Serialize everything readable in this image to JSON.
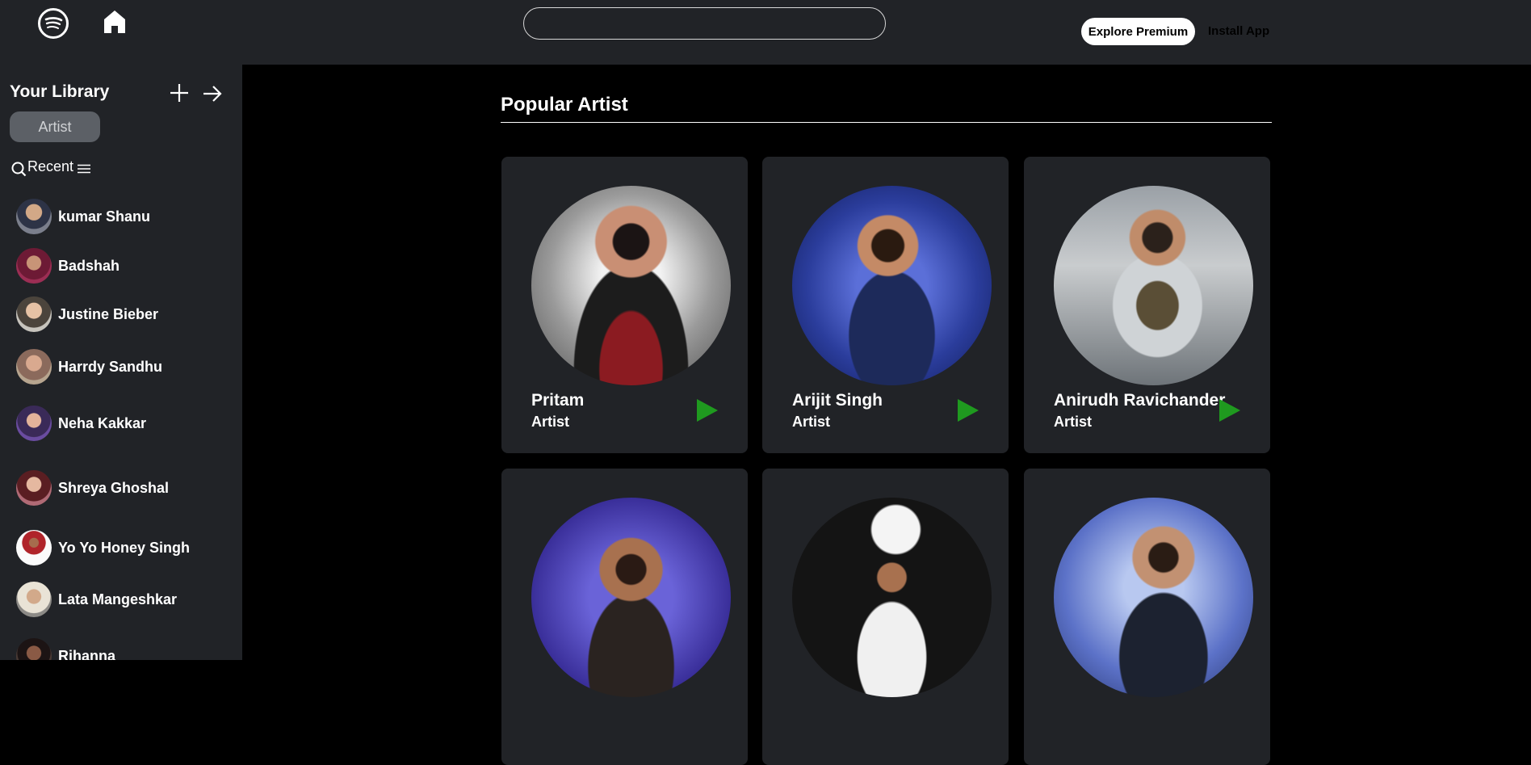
{
  "topbar": {
    "logo_icon": "spotify-logo-icon",
    "home_icon": "home-icon",
    "search_placeholder": "",
    "search_value": "",
    "premium_label": "Explore Premium",
    "install_label": "Install App"
  },
  "sidebar": {
    "title": "Your Library",
    "chip_label": "Artist",
    "recent_label": "Recent",
    "artists": [
      {
        "name": "kumar Shanu"
      },
      {
        "name": "Badshah"
      },
      {
        "name": "Justine Bieber"
      },
      {
        "name": "Harrdy Sandhu"
      },
      {
        "name": "Neha Kakkar"
      },
      {
        "name": "Shreya Ghoshal"
      },
      {
        "name": "Yo Yo Honey Singh"
      },
      {
        "name": "Lata Mangeshkar"
      },
      {
        "name": "Rihanna"
      }
    ]
  },
  "main": {
    "section_title": "Popular Artist",
    "cards": [
      {
        "name": "Pritam",
        "subtitle": "Artist"
      },
      {
        "name": "Arijit Singh",
        "subtitle": "Artist"
      },
      {
        "name": "Anirudh Ravichander",
        "subtitle": "Artist"
      },
      {
        "name": "",
        "subtitle": ""
      },
      {
        "name": "",
        "subtitle": ""
      },
      {
        "name": "",
        "subtitle": ""
      }
    ]
  },
  "colors": {
    "panel": "#212327",
    "background": "#000000",
    "play": "#1f9a1f",
    "chip": "#5c6066"
  }
}
